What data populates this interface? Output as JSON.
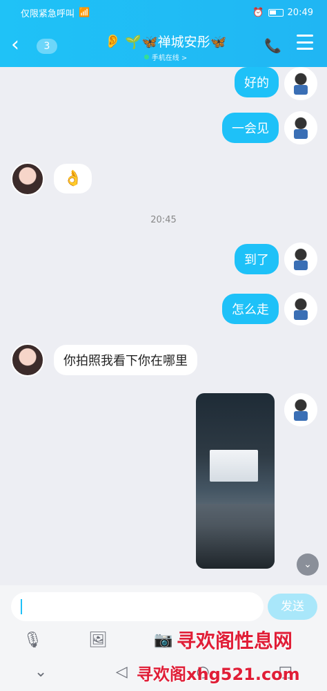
{
  "status_bar": {
    "carrier": "仅限紧急呼叫",
    "time": "20:49"
  },
  "header": {
    "back_icon": "chevron-left-icon",
    "unread_count": "3",
    "title": "🌱🦋禅城安彤🦋",
    "subtitle": "手机在线 >",
    "call_icon": "phone-icon",
    "menu_icon": "menu-icon"
  },
  "messages": [
    {
      "side": "out",
      "text": "好的"
    },
    {
      "side": "out",
      "text": "一会见"
    },
    {
      "side": "in",
      "text": "👌"
    },
    {
      "side": "time",
      "text": "20:45"
    },
    {
      "side": "out",
      "text": "到了"
    },
    {
      "side": "out",
      "text": "怎么走"
    },
    {
      "side": "in",
      "text": "你拍照我看下你在哪里"
    },
    {
      "side": "out",
      "type": "image"
    }
  ],
  "input": {
    "placeholder": "",
    "send_label": "发送"
  },
  "toolbar": [
    "mic-icon",
    "image-icon",
    "camera-icon"
  ],
  "watermark": {
    "line1": "寻欢阁性息网",
    "line2": "寻欢阁xhg521.com"
  }
}
